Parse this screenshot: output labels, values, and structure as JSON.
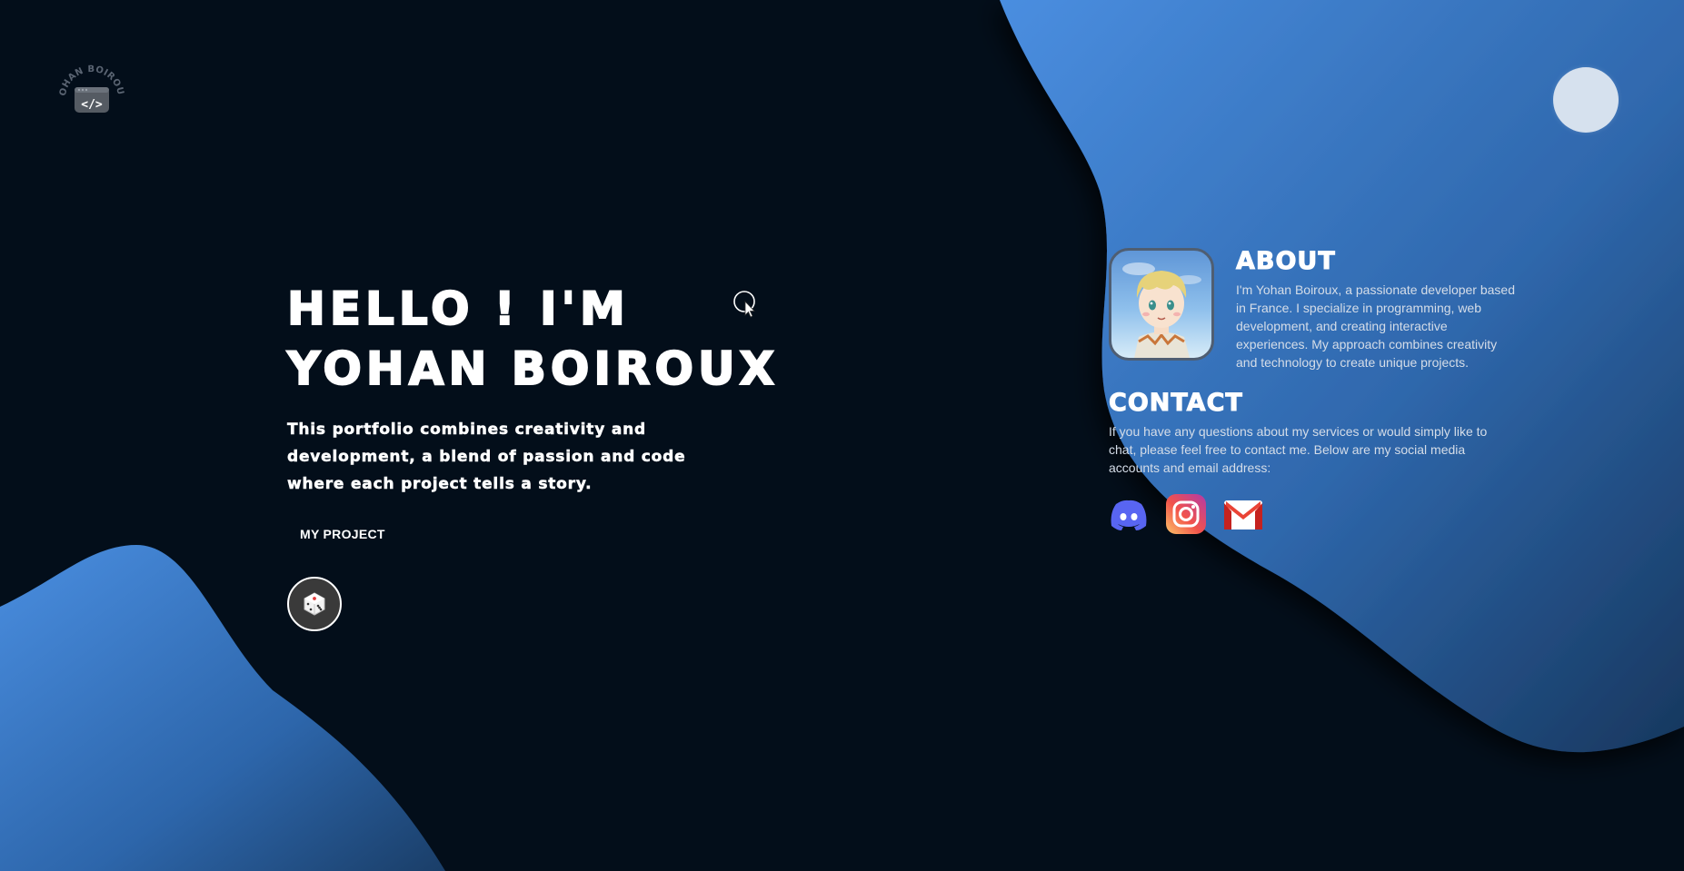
{
  "logo": {
    "circle_text": "YOHAN BOIROUX",
    "code_symbol": "</>"
  },
  "hero": {
    "title_line1": "HELLO ! I'M",
    "title_line2": "YOHAN BOIROUX",
    "subtitle": "This portfolio combines creativity and development, a blend of passion and code where each project tells a story.",
    "project_button": "MY PROJECT",
    "random_button_icon": "dice-icon"
  },
  "about": {
    "title": "ABOUT",
    "text": "I'm Yohan Boiroux, a passionate developer based in France. I specialize in programming, web development, and creating interactive experiences. My approach combines creativity and technology to create unique projects."
  },
  "contact": {
    "title": "CONTACT",
    "text": "If you have any questions about my services or would simply like to chat, please feel free to contact me. Below are my social media accounts and email address:",
    "socials": [
      {
        "name": "discord-icon",
        "color": "#5865f2"
      },
      {
        "name": "instagram-icon",
        "color": "#e4405f"
      },
      {
        "name": "gmail-icon",
        "color": "#ea4335"
      }
    ]
  },
  "colors": {
    "background": "#030e1a",
    "wave_light": "#4a8ee0",
    "wave_dark": "#17375e",
    "moon": "#d6e1ee"
  }
}
